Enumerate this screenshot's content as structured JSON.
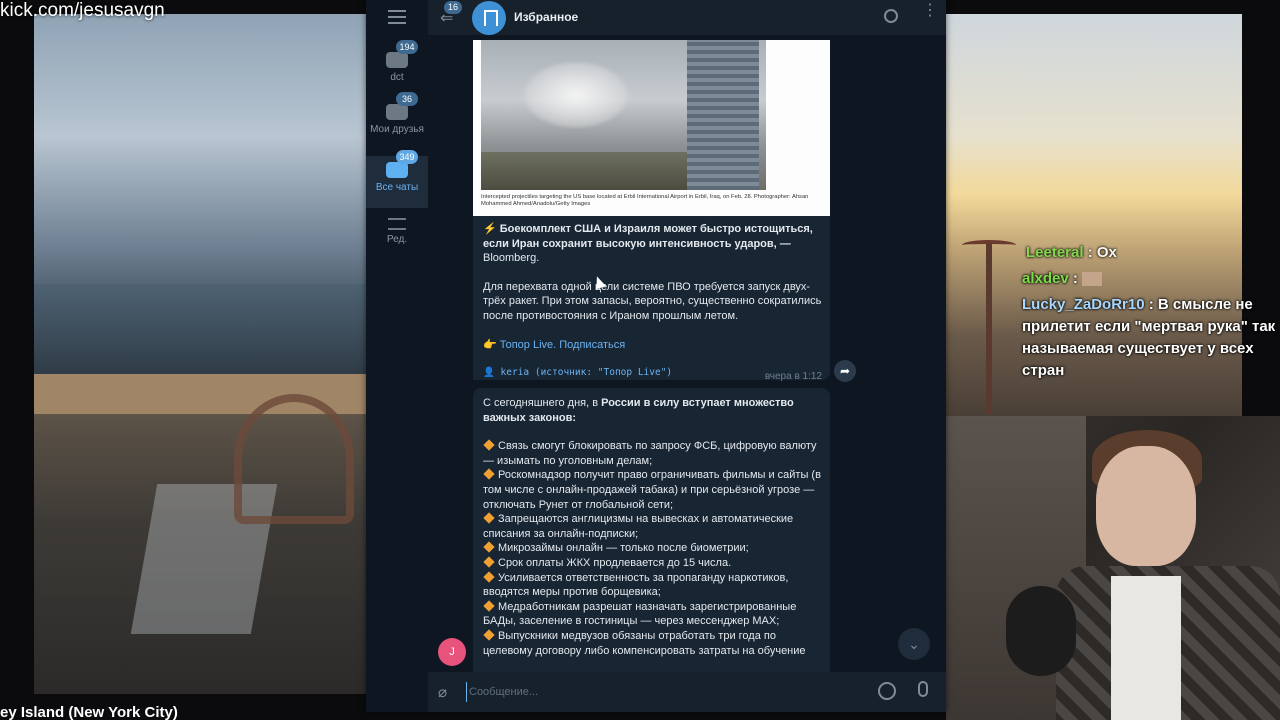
{
  "stream": {
    "watermark": "kick.com/jesusavgn",
    "bg_caption": "ey Island (New York City)"
  },
  "chat": [
    {
      "nick": "Leeteral",
      "text": "Ох",
      "cut": true
    },
    {
      "nick": "alxdev",
      "text": ""
    },
    {
      "nick": "Lucky_ZaDoRr10",
      "text": "В смысле не прилетит если \"мертвая рука\" так называемая существует у всех стран"
    }
  ],
  "telegram": {
    "folders": [
      {
        "label": "dct",
        "badge": "194"
      },
      {
        "label": "Мои друзья",
        "badge": "36"
      },
      {
        "label": "Все чаты",
        "badge": "349",
        "active": true
      },
      {
        "label": "Ред."
      }
    ],
    "header": {
      "title": "Избранное",
      "back_badge": "16"
    },
    "message1": {
      "photo_caption": "Intercepted projectiles targeting the US base located at Erbil International Airport in Erbil, Iraq, on Feb. 28. Photographer: Ahsan Mohammed Ahmed/Anadolu/Getty Images",
      "headline": "⚡ Боекомплект США и Израиля может быстро истощиться, если Иран сохранит высокую интенсивность ударов, —",
      "source": "Bloomberg.",
      "body": "Для перехвата одной цели системе ПВО требуется запуск двух-трёх ракет. При этом запасы, вероятно, существенно сократились после противостояния с Ираном прошлым летом.",
      "subscribe": "👉 Топор Live. Подписаться",
      "forwarded": "👤 keria (источник: \"Топор Live\")",
      "time": "вчера в 1:12"
    },
    "message2": {
      "intro_plain": "С сегодняшнего дня, в ",
      "intro_bold": "России в силу вступает множество важных законов:",
      "items": [
        "Связь смогут блокировать по запросу ФСБ, цифровую валюту — изымать по уголовным делам;",
        "Роскомнадзор получит право ограничивать фильмы и сайты (в том числе с онлайн-продажей табака) и при серьёзной угрозе — отключать Рунет от глобальной сети;",
        "Запрещаются англицизмы на вывесках и автоматические списания за онлайн-подписки;",
        "Микрозаймы онлайн — только после биометрии;",
        "Срок оплаты ЖКХ продлевается до 15 числа.",
        "Усиливается ответственность за пропаганду наркотиков, вводятся меры против борщевика;",
        "Медработникам разрешат назначать зарегистрированные БАДы, заселение в гостиницы — через мессенджер MAX;",
        "Выпускники медвузов обязаны отработать три года по целевому договору либо компенсировать затраты на обучение"
      ]
    },
    "avatar_letter": "J",
    "composer": {
      "placeholder": "Сообщение..."
    }
  }
}
